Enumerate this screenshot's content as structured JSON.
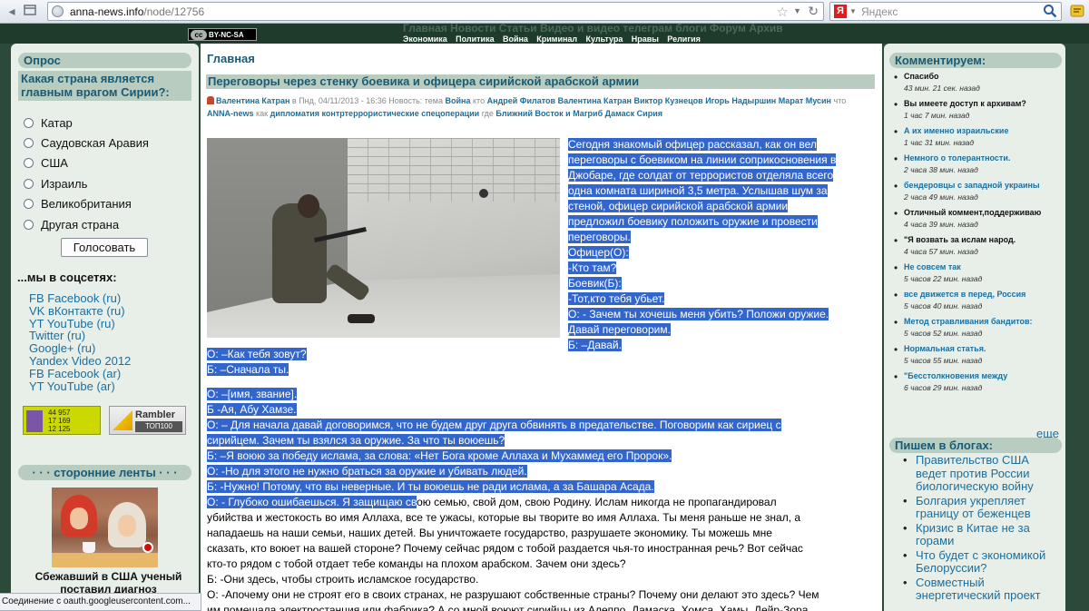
{
  "browser": {
    "url_domain": "anna-news.info",
    "url_path": "/node/12756",
    "search_engine": "Я",
    "search_placeholder": "Яндекс"
  },
  "site": {
    "license_badge_cc": "cc",
    "license_badge": "BY-NC-SA",
    "top_menu_ghost": "Главная Новости Статьи Видео и видео телеграм блоги Форум Архив",
    "top_menu": [
      "Экономика",
      "Политика",
      "Война",
      "Криминал",
      "Культура",
      "Нравы",
      "Религия"
    ]
  },
  "poll": {
    "title": "Опрос",
    "question": "Какая страна является главным врагом Сирии?:",
    "options": [
      "Катар",
      "Саудовская Аравия",
      "США",
      "Израиль",
      "Великобритания",
      "Другая страна"
    ],
    "vote_button": "Голосовать"
  },
  "social": {
    "title": "...мы в соцсетях:",
    "links": [
      "FB Facebook (ru)",
      "VK вКонтакте (ru)",
      "YT YouTube (ru)",
      "Twitter (ru)",
      "Google+ (ru)",
      "Yandex Video 2012",
      "FB Facebook (ar)",
      "YT YouTube (ar)"
    ]
  },
  "counters": {
    "liveinternet": [
      "44 957",
      "17 169",
      "12 125"
    ],
    "rambler_name": "Rambler",
    "rambler_top": "ТОП100"
  },
  "feeds": {
    "title": "· · · сторонние ленты · · ·",
    "caption": "Сбежавший в США ученый поставил диагноз"
  },
  "article": {
    "breadcrumb": "Главная",
    "title": "Переговоры через стенку боевика и офицера сирийской арабской армии",
    "meta": {
      "author": "Валентина Катран",
      "date_text": "в Пнд, 04/11/2013 - 16:36 Новость: тема",
      "topic": "Война",
      "who_label": "кто",
      "who": [
        "Андрей Филатов",
        "Валентина Катран",
        "Виктор Кузнецов",
        "Игорь Надыршин",
        "Марат Мусин"
      ],
      "what_label": "что",
      "what": "ANNA-news",
      "how_label": "как",
      "how": [
        "дипломатия",
        "контртеррористические спецоперации"
      ],
      "where_label": "где",
      "where": [
        "Ближний Восток и Магриб",
        "Дамаск",
        "Сирия"
      ]
    },
    "intro_lines": [
      "Сегодня знакомый офицер рассказал, как он вел",
      "переговоры с боевиком на линии соприкосновения в",
      "Джобаре, где солдат от террористов отделяла всего",
      "одна комната шириной 3,5 метра. Услышав шум за",
      "стеной, офицер сирийской арабской армии",
      "предложил боевику положить оружие и провести",
      "переговоры."
    ],
    "dialogue_right": [
      "Офицер(О):",
      "-Кто там?",
      "Боевик(Б):",
      "-Тот,кто тебя убьет.",
      "О: - Зачем ты хочешь меня убить? Положи оружие.",
      "Давай переговорим.",
      "Б: –Давай."
    ],
    "dialogue_a": [
      "О: –Как тебя зовут?",
      "Б: –Сначала ты."
    ],
    "dialogue_b_lines": [
      "О: –[имя, звание].",
      "Б -Ая, Абу Хамзе.",
      "О: – Для начала давай договоримся, что не будем друг друга обвинять в предательстве. Поговорим как сириец с",
      "сирийцем. Зачем ты взялся за оружие. За что ты воюешь?",
      "Б: –Я воюю за победу ислама, за слова: «Нет Бога кроме Аллаха и Мухаммед его Пророк».",
      "О: -Но для этого не нужно браться за оружие и убивать людей.",
      "Б: -Нужно! Потому, что вы неверные. И ты воюешь не ради ислама, а за Башара Асада."
    ],
    "answer_sel": "О: - Глубоко ошибаешься. Я защищаю св",
    "answer_rest": "ою семью, свой дом, свою Родину. Ислам никогда не пропагандировал",
    "plain_lines": [
      "убийства и жестокость во имя Аллаха, все те ужасы, которые вы творите во имя Аллаха. Ты меня раньше не знал, а",
      "нападаешь на наши семьи, наших детей. Вы уничтожаете государство, разрушаете экономику. Ты можешь мне",
      "сказать, кто воюет на вашей стороне? Почему сейчас рядом с тобой раздается чья-то иностранная речь? Вот сейчас",
      "кто-то рядом с тобой отдает тебе команды на плохом арабском. Зачем они здесь?",
      "Б: -Они здесь, чтобы строить исламское государство.",
      "О: -Апочему они не строят его в своих странах, не разрушают собственные страны? Почему они делают это здесь? Чем",
      "им помешала электростанция или фабрика? А со мной воюют сирийцы из Алеппо, Дамаска, Хомса, Хамы, Дейр-Зора,"
    ]
  },
  "comments": {
    "title": "Комментируем:",
    "items": [
      {
        "title": "Спасибо",
        "time": "43 мин. 21 сек. назад",
        "style": "dark"
      },
      {
        "title": "Вы имеете доступ к архивам?",
        "time": "1 час 7 мин. назад",
        "style": "dark"
      },
      {
        "title": "А их именно израильские",
        "time": "1 час 31 мин. назад",
        "style": "link"
      },
      {
        "title": "Немного о толерантности.",
        "time": "2 часа 38 мин. назад",
        "style": "link"
      },
      {
        "title": "бендеровцы с западной украины",
        "time": "2 часа 49 мин. назад",
        "style": "link"
      },
      {
        "title": "Отличный коммент,поддерживаю",
        "time": "4 часа 39 мин. назад",
        "style": "dark"
      },
      {
        "title": "\"Я возвать за ислам народ.",
        "time": "4 часа 57 мин. назад",
        "style": "dark"
      },
      {
        "title": "Не совсем так",
        "time": "5 часов 22 мин. назад",
        "style": "link"
      },
      {
        "title": "все движется в перед, Россия",
        "time": "5 часов 40 мин. назад",
        "style": "link"
      },
      {
        "title": "Метод стравливания бандитов:",
        "time": "5 часов 52 мин. назад",
        "style": "link"
      },
      {
        "title": "Нормальная статья.",
        "time": "5 часов 55 мин. назад",
        "style": "link"
      },
      {
        "title": "\"Бесстолкновения между",
        "time": "6 часов 29 мин. назад",
        "style": "link"
      }
    ],
    "more": "еще"
  },
  "blogs": {
    "title": "Пишем в блогах:",
    "items": [
      "Правительство США ведет против России биологическую войну",
      "Болгария укрепляет границу от беженцев",
      "Кризис в Китае не за горами",
      "Что будет с экономикой Белоруссии?",
      "Совместный энергетический проект"
    ]
  },
  "status": {
    "text": "Соединение с oauth.googleusercontent.com..."
  },
  "colors": {
    "accent": "#1a5a73",
    "link": "#1a6fa0",
    "block_bg": "#b8ccc0",
    "column_bg": "#e8efe9",
    "page_bg": "#2b4a3a",
    "selection": "#3366cc"
  }
}
